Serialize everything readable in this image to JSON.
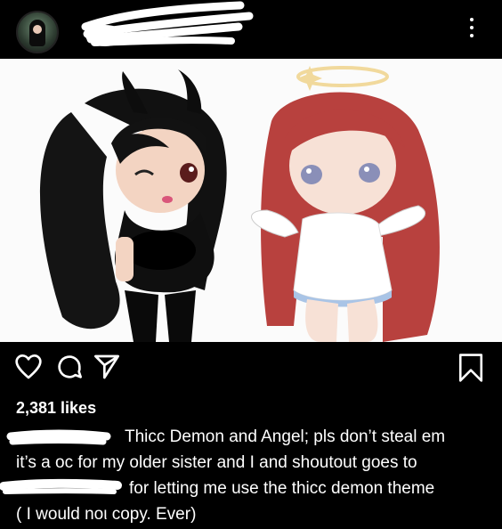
{
  "post": {
    "likes": "2,381 likes",
    "caption_lines": [
      "Thicc Demon and Angel; pls don’t steal em",
      "it’s a oc for my older sister and I and shoutout goes to",
      "for letting me use the thicc demon theme",
      "( I would noι copy. Ever)"
    ]
  },
  "icons": {
    "more": "more-vertical-icon",
    "like": "heart-icon",
    "comment": "comment-icon",
    "share": "send-icon",
    "save": "bookmark-icon"
  },
  "colors": {
    "background": "#000000",
    "text": "#ffffff",
    "redaction": "#ffffff"
  }
}
